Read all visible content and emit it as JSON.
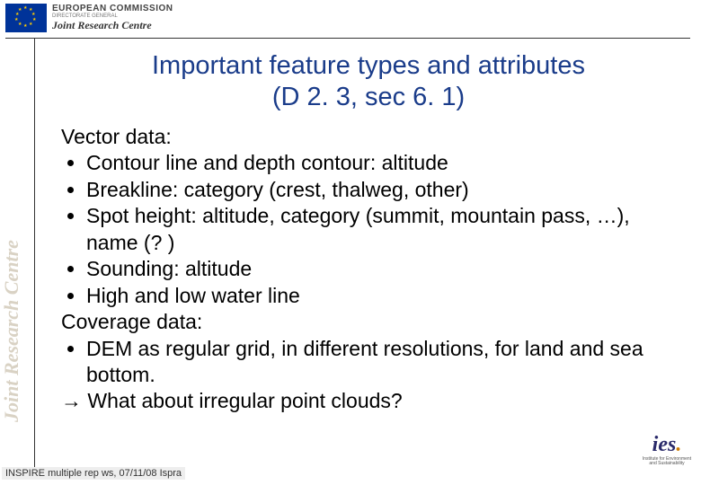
{
  "header": {
    "org_top": "EUROPEAN COMMISSION",
    "org_mid": "DIRECTORATE GENERAL",
    "org_bot": "Joint Research Centre"
  },
  "sidebar": {
    "label": "Joint Research Centre"
  },
  "title": {
    "line1": "Important feature types and attributes",
    "line2": "(D 2. 3, sec 6. 1)"
  },
  "content": {
    "vector_hdr": "Vector data:",
    "items": [
      "Contour line and depth contour: altitude",
      "Breakline: category (crest, thalweg, other)",
      "Spot height: altitude, category (summit, mountain pass, …), name (? )",
      "Sounding: altitude",
      "High and low water line"
    ],
    "coverage_hdr": "Coverage data:",
    "coverage_items": [
      "DEM as regular grid, in different resolutions, for land and sea bottom."
    ],
    "arrow_line": "What about irregular point clouds?"
  },
  "footer": {
    "text": "INSPIRE multiple rep ws, 07/11/08 Ispra"
  },
  "ies": {
    "mark": "ies",
    "sub": "Institute for Environment and Sustainability"
  }
}
